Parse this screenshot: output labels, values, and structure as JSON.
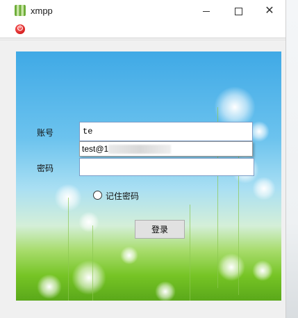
{
  "window": {
    "title": "xmpp"
  },
  "icons": {
    "app": "app-icon",
    "power": "power-icon"
  },
  "colors": {
    "accent": "#3fa9e6",
    "grass": "#76c425",
    "power": "#d00000"
  },
  "login": {
    "account_label": "账号",
    "account_value": "te",
    "password_label": "密码",
    "password_value": "",
    "remember_label": "记住密码",
    "remember_checked": false,
    "submit_label": "登录"
  },
  "autocomplete": {
    "item": "test@1"
  }
}
